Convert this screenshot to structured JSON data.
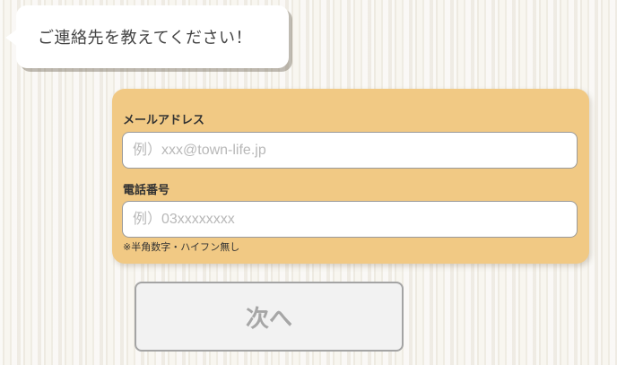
{
  "bubble": {
    "message": "ご連絡先を教えてください！"
  },
  "form": {
    "email": {
      "label": "メールアドレス",
      "value": "",
      "placeholder": "例）xxx@town-life.jp"
    },
    "phone": {
      "label": "電話番号",
      "value": "",
      "placeholder": "例）03xxxxxxxx",
      "note": "※半角数字・ハイフン無し"
    }
  },
  "next_button": {
    "label": "次へ"
  },
  "colors": {
    "card": "#f1c984",
    "button_bg": "#f2f2f2",
    "button_text": "#a6a6a6"
  }
}
